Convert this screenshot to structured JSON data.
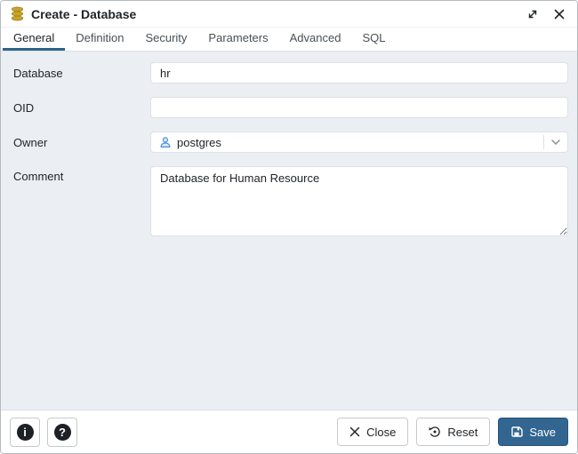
{
  "window": {
    "title": "Create - Database"
  },
  "tabs": [
    {
      "label": "General",
      "active": true
    },
    {
      "label": "Definition",
      "active": false
    },
    {
      "label": "Security",
      "active": false
    },
    {
      "label": "Parameters",
      "active": false
    },
    {
      "label": "Advanced",
      "active": false
    },
    {
      "label": "SQL",
      "active": false
    }
  ],
  "form": {
    "fields": [
      {
        "label": "Database",
        "type": "text",
        "value": "hr"
      },
      {
        "label": "OID",
        "type": "text",
        "value": ""
      },
      {
        "label": "Owner",
        "type": "select",
        "value": "postgres",
        "icon": "user-icon"
      },
      {
        "label": "Comment",
        "type": "textarea",
        "value": "Database for Human Resource"
      }
    ]
  },
  "footer": {
    "info_glyph": "i",
    "help_glyph": "?",
    "close_label": "Close",
    "reset_label": "Reset",
    "save_label": "Save"
  },
  "icons": {
    "titlebar": "database-icon",
    "window_expand": "expand-icon",
    "window_close": "close-icon",
    "owner_field": "user-icon",
    "owner_dropdown": "chevron-down-icon",
    "info_button": "info-icon",
    "help_button": "help-icon",
    "close_button": "x-icon",
    "reset_button": "reset-icon",
    "save_button": "floppy-icon"
  },
  "colors": {
    "accent": "#326690",
    "tab_underline": "#2c6487",
    "body_bg": "#ebeef3",
    "control_border": "#dde0e4",
    "db_icon_gold": "#c9a425",
    "user_icon_blue": "#4a90d9"
  }
}
